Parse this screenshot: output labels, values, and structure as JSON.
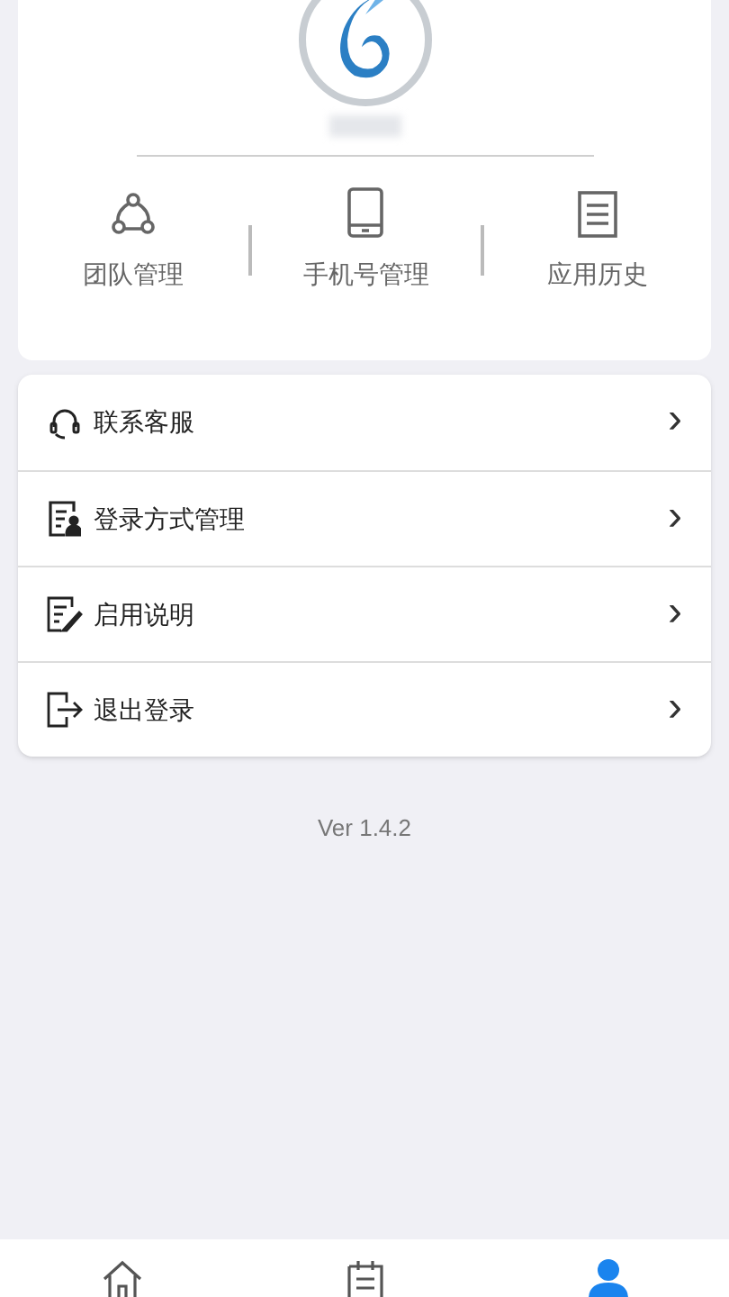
{
  "shortcuts": [
    {
      "kind": "team",
      "label": "团队管理"
    },
    {
      "kind": "phone",
      "label": "手机号管理"
    },
    {
      "kind": "history",
      "label": "应用历史"
    }
  ],
  "menu": [
    {
      "kind": "headset",
      "label": "联系客服",
      "chevron": "›"
    },
    {
      "kind": "login",
      "label": "登录方式管理",
      "chevron": "›"
    },
    {
      "kind": "guide",
      "label": "启用说明",
      "chevron": "›"
    },
    {
      "kind": "logout",
      "label": "退出登录",
      "chevron": "›"
    }
  ],
  "version": "Ver 1.4.2",
  "tabs": [
    {
      "kind": "home",
      "selected": false
    },
    {
      "kind": "calendar",
      "selected": false
    },
    {
      "kind": "profile",
      "selected": true
    }
  ]
}
